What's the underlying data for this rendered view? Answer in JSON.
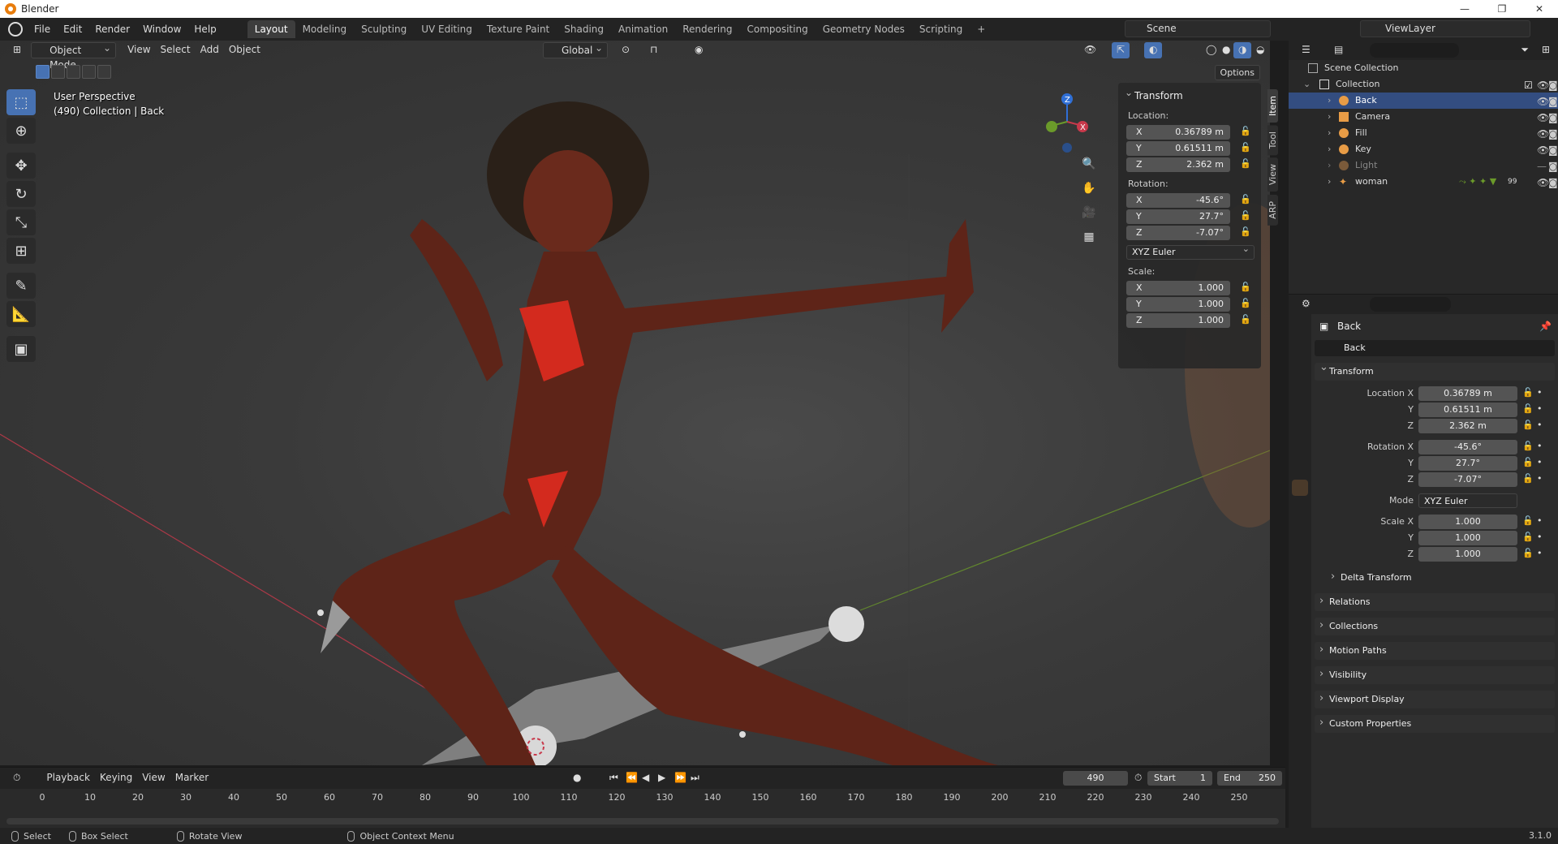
{
  "app": {
    "title": "Blender",
    "version": "3.1.0"
  },
  "menu": [
    "File",
    "Edit",
    "Render",
    "Window",
    "Help"
  ],
  "workspaces": [
    "Layout",
    "Modeling",
    "Sculpting",
    "UV Editing",
    "Texture Paint",
    "Shading",
    "Animation",
    "Rendering",
    "Compositing",
    "Geometry Nodes",
    "Scripting"
  ],
  "workspace_add": "+",
  "scene": "Scene",
  "view_layer": "ViewLayer",
  "viewport": {
    "mode": "Object Mode",
    "menus": [
      "View",
      "Select",
      "Add",
      "Object"
    ],
    "orientation": "Global",
    "options": "Options",
    "info_line1": "User Perspective",
    "info_line2": "(490) Collection | Back"
  },
  "npanel": {
    "title": "Transform",
    "location_label": "Location:",
    "location": [
      {
        "ax": "X",
        "v": "0.36789 m"
      },
      {
        "ax": "Y",
        "v": "0.61511 m"
      },
      {
        "ax": "Z",
        "v": "2.362 m"
      }
    ],
    "rotation_label": "Rotation:",
    "rotation": [
      {
        "ax": "X",
        "v": "-45.6°"
      },
      {
        "ax": "Y",
        "v": "27.7°"
      },
      {
        "ax": "Z",
        "v": "-7.07°"
      }
    ],
    "rotation_mode": "XYZ Euler",
    "scale_label": "Scale:",
    "scale": [
      {
        "ax": "X",
        "v": "1.000"
      },
      {
        "ax": "Y",
        "v": "1.000"
      },
      {
        "ax": "Z",
        "v": "1.000"
      }
    ],
    "tabs": [
      "Item",
      "Tool",
      "View",
      "ARP"
    ]
  },
  "outliner": {
    "scene_collection": "Scene Collection",
    "collection": "Collection",
    "items": [
      "Back",
      "Camera",
      "Fill",
      "Key",
      "Light",
      "woman"
    ],
    "badge_woman": "99"
  },
  "properties": {
    "object_name": "Back",
    "data_name": "Back",
    "transform": "Transform",
    "location_x_label": "Location X",
    "y_label": "Y",
    "z_label": "Z",
    "location": [
      "0.36789 m",
      "0.61511 m",
      "2.362 m"
    ],
    "rotation_x_label": "Rotation X",
    "rotation": [
      "-45.6°",
      "27.7°",
      "-7.07°"
    ],
    "mode_label": "Mode",
    "mode": "XYZ Euler",
    "scale_x_label": "Scale X",
    "scale": [
      "1.000",
      "1.000",
      "1.000"
    ],
    "sections": [
      "Delta Transform",
      "Relations",
      "Collections",
      "Motion Paths",
      "Visibility",
      "Viewport Display",
      "Custom Properties"
    ]
  },
  "timeline": {
    "menus": [
      "Playback",
      "Keying",
      "View",
      "Marker"
    ],
    "current_frame": "490",
    "start_label": "Start",
    "start": "1",
    "end_label": "End",
    "end": "250",
    "ticks": [
      "0",
      "10",
      "20",
      "30",
      "40",
      "50",
      "60",
      "70",
      "80",
      "90",
      "100",
      "110",
      "120",
      "130",
      "140",
      "150",
      "160",
      "170",
      "180",
      "190",
      "200",
      "210",
      "220",
      "230",
      "240",
      "250"
    ]
  },
  "status": [
    "Select",
    "Box Select",
    "Rotate View",
    "Object Context Menu"
  ],
  "colors": {
    "accent": "#4772b3",
    "selected_row": "#334d80",
    "x_axis": "#c8394b",
    "y_axis": "#6b9a2a",
    "z_axis": "#2f6fd6"
  }
}
